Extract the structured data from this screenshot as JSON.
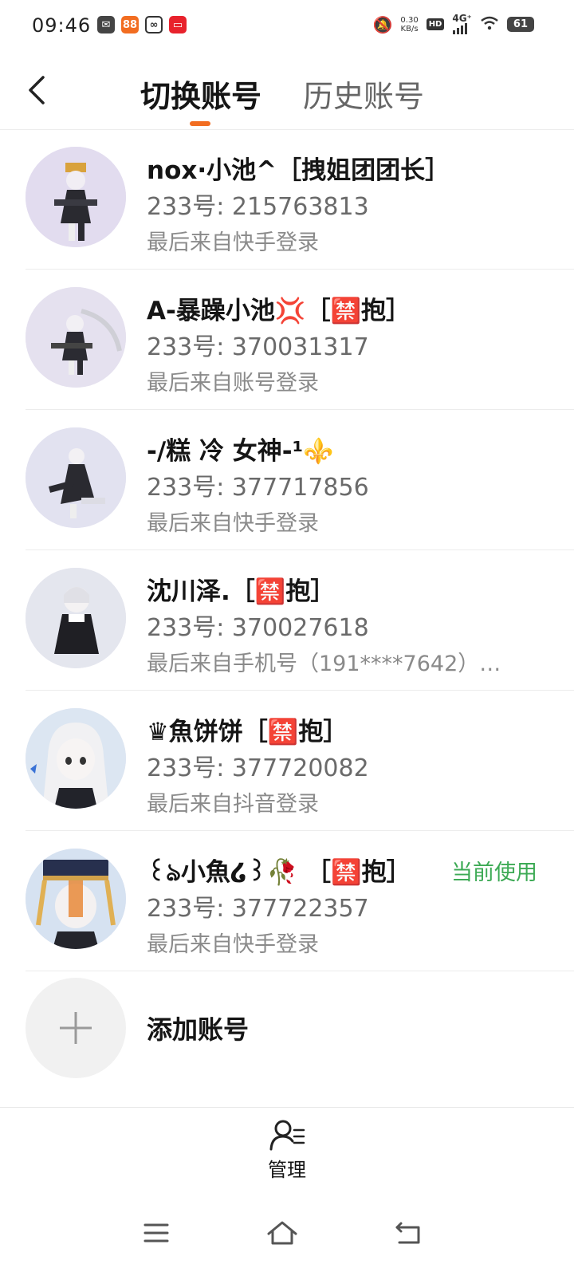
{
  "status_bar": {
    "time": "09:46",
    "net_speed_value": "0.30",
    "net_speed_unit": "KB/s",
    "hd": "HD",
    "network": "4G⁺",
    "battery": "61"
  },
  "header": {
    "tab_switch": "切换账号",
    "tab_history": "历史账号",
    "accent_color": "#f26d21"
  },
  "accounts": [
    {
      "name": "nox·小池^［拽姐团团长］",
      "id": "233号: 215763813",
      "login": "最后来自快手登录",
      "current": ""
    },
    {
      "name": "A-暴躁小池💢［🈲抱］",
      "id": "233号: 370031317",
      "login": "最后来自账号登录",
      "current": ""
    },
    {
      "name": "-/糕 冷  女神-¹⚜️",
      "id": "233号: 377717856",
      "login": "最后来自快手登录",
      "current": ""
    },
    {
      "name": "沈川泽.［🈲抱］",
      "id": "233号: 370027618",
      "login": "最后来自手机号（191****7642）…",
      "current": ""
    },
    {
      "name": "♛魚饼饼［🈲抱］",
      "id": "233号: 377720082",
      "login": "最后来自抖音登录",
      "current": ""
    },
    {
      "name": "꒰ঌ小魚໒꒱🥀 ［🈲抱］",
      "id": "233号: 377722357",
      "login": "最后来自快手登录",
      "current": "当前使用"
    }
  ],
  "add_account": {
    "label": "添加账号"
  },
  "bottom": {
    "manage_label": "管理"
  },
  "colors": {
    "current_badge": "#3daa55"
  }
}
